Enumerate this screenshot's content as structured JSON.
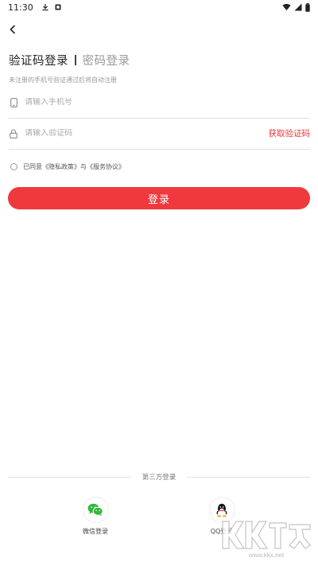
{
  "status_bar": {
    "time": "11:30",
    "icons": [
      "download-icon",
      "notification-icon",
      "wifi-icon",
      "signal-icon",
      "battery-icon"
    ]
  },
  "nav": {
    "back_icon": "chevron-left-icon"
  },
  "tabs": [
    {
      "label": "验证码登录",
      "active": true
    },
    {
      "label": "密码登录",
      "active": false
    }
  ],
  "hint": "未注册的手机号验证通过后将自动注册",
  "phone_field": {
    "placeholder": "请输入手机号",
    "value": "",
    "icon": "phone-icon"
  },
  "code_field": {
    "placeholder": "请输入验证码",
    "value": "",
    "icon": "lock-icon",
    "action_label": "获取验证码"
  },
  "agreement": {
    "text": "已同意《隐私政策》与《服务协议》",
    "checked": false
  },
  "login_button": {
    "label": "登录"
  },
  "third_party": {
    "title": "第三方登录",
    "items": [
      {
        "label": "微信登录",
        "icon": "wechat-icon"
      },
      {
        "label": "QQ登录",
        "icon": "qq-icon"
      }
    ]
  },
  "watermark": {
    "text": "KK下载",
    "url_text": "www.kkx.net"
  },
  "colors": {
    "accent": "#f0393d",
    "link": "#e9353b",
    "wechat": "#35b73b"
  }
}
